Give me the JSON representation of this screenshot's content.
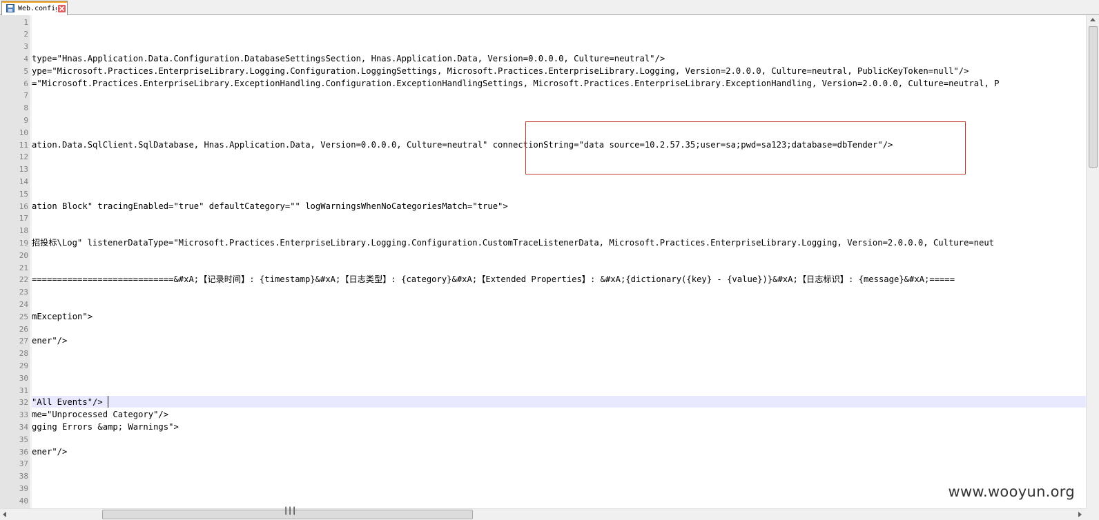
{
  "tab": {
    "label": "Web.config",
    "icon": "save-file-icon",
    "close_icon": "close-icon",
    "accent_color": "#f5a623"
  },
  "editor": {
    "line_numbers": [
      "1",
      "2",
      "3",
      "4",
      "5",
      "6",
      "7",
      "8",
      "9",
      "10",
      "11",
      "12",
      "13",
      "14",
      "15",
      "16",
      "17",
      "18",
      "19",
      "20",
      "21",
      "22",
      "23",
      "24",
      "25",
      "26",
      "27",
      "28",
      "29",
      "30",
      "31",
      "32",
      "33",
      "34",
      "35",
      "36",
      "37",
      "38",
      "39",
      "40"
    ],
    "lines": [
      "",
      "",
      "",
      "type=\"Hnas.Application.Data.Configuration.DatabaseSettingsSection, Hnas.Application.Data, Version=0.0.0.0, Culture=neutral\"/>",
      "ype=\"Microsoft.Practices.EnterpriseLibrary.Logging.Configuration.LoggingSettings, Microsoft.Practices.EnterpriseLibrary.Logging, Version=2.0.0.0, Culture=neutral, PublicKeyToken=null\"/>",
      "=\"Microsoft.Practices.EnterpriseLibrary.ExceptionHandling.Configuration.ExceptionHandlingSettings, Microsoft.Practices.EnterpriseLibrary.ExceptionHandling, Version=2.0.0.0, Culture=neutral, P",
      "",
      "",
      "",
      "",
      "ation.Data.SqlClient.SqlDatabase, Hnas.Application.Data, Version=0.0.0.0, Culture=neutral\" connectionString=\"data source=10.2.57.35;user=sa;pwd=sa123;database=dbTender\"/>",
      "",
      "",
      "",
      "",
      "ation Block\" tracingEnabled=\"true\" defaultCategory=\"\" logWarningsWhenNoCategoriesMatch=\"true\">",
      "",
      "",
      "招投标\\Log\" listenerDataType=\"Microsoft.Practices.EnterpriseLibrary.Logging.Configuration.CustomTraceListenerData, Microsoft.Practices.EnterpriseLibrary.Logging, Version=2.0.0.0, Culture=neut",
      "",
      "",
      "============================&#xA;【记录时间】: {timestamp}&#xA;【日志类型】: {category}&#xA;【Extended Properties】: &#xA;{dictionary({key} - {value})}&#xA;【日志标识】: {message}&#xA;=====",
      "",
      "",
      "mException\">",
      "",
      "ener\"/>",
      "",
      "",
      "",
      "",
      "\"All Events\"/>",
      "me=\"Unprocessed Category\"/>",
      "gging Errors &amp; Warnings\">",
      "",
      "ener\"/>",
      "",
      "",
      "",
      ""
    ],
    "current_line": 32,
    "highlight_color": "#c0392b"
  },
  "watermark": "www.wooyun.org"
}
